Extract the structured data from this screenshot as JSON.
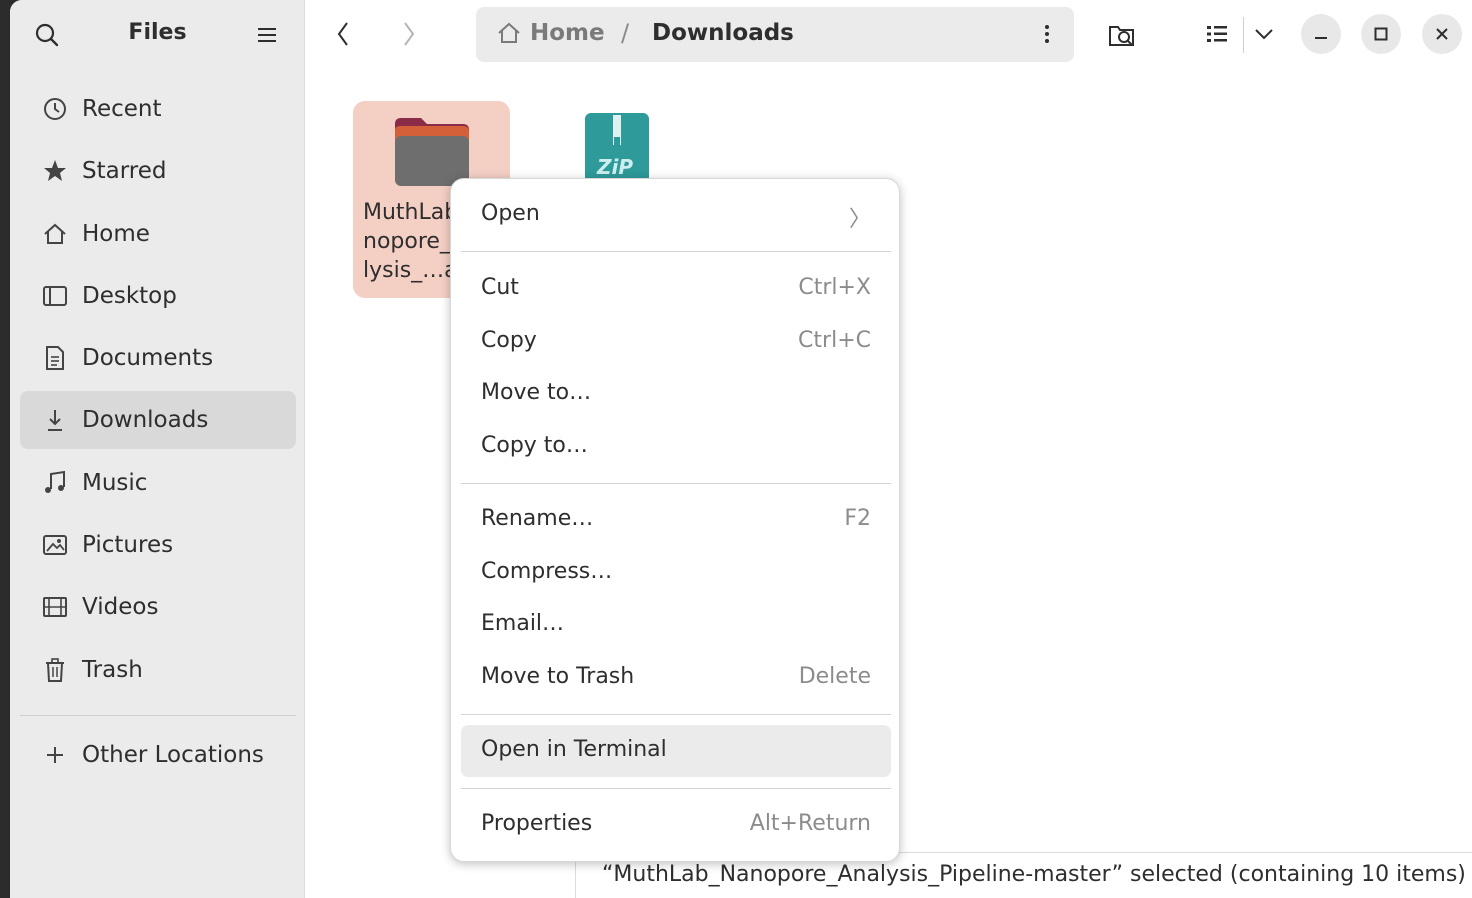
{
  "app": {
    "title": "Files"
  },
  "sidebar": {
    "items": [
      {
        "label": "Recent",
        "icon": "clock-icon"
      },
      {
        "label": "Starred",
        "icon": "star-icon"
      },
      {
        "label": "Home",
        "icon": "home-icon"
      },
      {
        "label": "Desktop",
        "icon": "desktop-icon"
      },
      {
        "label": "Documents",
        "icon": "document-icon"
      },
      {
        "label": "Downloads",
        "icon": "download-icon",
        "active": true
      },
      {
        "label": "Music",
        "icon": "music-icon"
      },
      {
        "label": "Pictures",
        "icon": "picture-icon"
      },
      {
        "label": "Videos",
        "icon": "video-icon"
      },
      {
        "label": "Trash",
        "icon": "trash-icon"
      }
    ],
    "other_locations": "Other Locations"
  },
  "pathbar": {
    "home": "Home",
    "separator": "/",
    "current": "Downloads"
  },
  "files": [
    {
      "name": "MuthLab nopore_ lysis_…a",
      "type": "folder",
      "selected": true
    },
    {
      "name": "",
      "type": "zip",
      "badge": "ZiP"
    }
  ],
  "context_menu": {
    "groups": [
      [
        {
          "label": "Open",
          "accel": "〉"
        }
      ],
      [
        {
          "label": "Cut",
          "accel": "Ctrl+X"
        },
        {
          "label": "Copy",
          "accel": "Ctrl+C"
        },
        {
          "label": "Move to…",
          "accel": ""
        },
        {
          "label": "Copy to…",
          "accel": ""
        }
      ],
      [
        {
          "label": "Rename…",
          "accel": "F2"
        },
        {
          "label": "Compress…",
          "accel": ""
        },
        {
          "label": "Email…",
          "accel": ""
        },
        {
          "label": "Move to Trash",
          "accel": "Delete"
        }
      ],
      [
        {
          "label": "Open in Terminal",
          "accel": "",
          "hover": true
        }
      ],
      [
        {
          "label": "Properties",
          "accel": "Alt+Return"
        }
      ]
    ]
  },
  "status": {
    "text": "“MuthLab_Nanopore_Analysis_Pipeline-master” selected  (containing 10 items)"
  }
}
